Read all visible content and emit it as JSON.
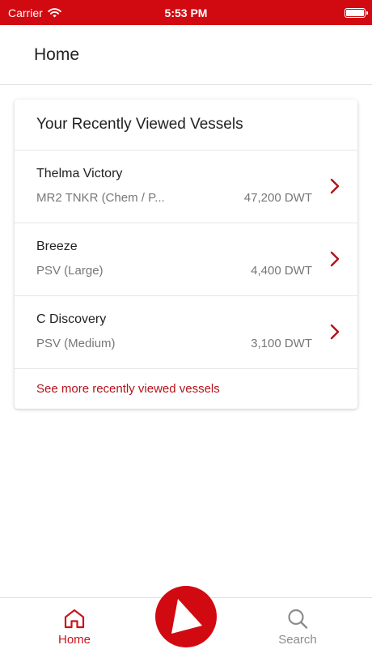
{
  "status_bar": {
    "carrier": "Carrier",
    "time": "5:53 PM"
  },
  "header": {
    "title": "Home"
  },
  "recent": {
    "title": "Your Recently Viewed Vessels",
    "vessels": [
      {
        "name": "Thelma Victory",
        "type": "MR2 TNKR (Chem / P...",
        "dwt": "47,200 DWT"
      },
      {
        "name": "Breeze",
        "type": "PSV (Large)",
        "dwt": "4,400 DWT"
      },
      {
        "name": "C Discovery",
        "type": "PSV (Medium)",
        "dwt": "3,100 DWT"
      }
    ],
    "see_more": "See more recently viewed vessels"
  },
  "tabbar": {
    "home_label": "Home",
    "search_label": "Search",
    "home_icon": "house-icon",
    "search_icon": "magnifier-icon",
    "center_icon": "play-triangle-icon"
  },
  "colors": {
    "brand_red": "#d10a11",
    "link_red": "#b3121a",
    "inactive_gray": "#8c8c8c"
  }
}
